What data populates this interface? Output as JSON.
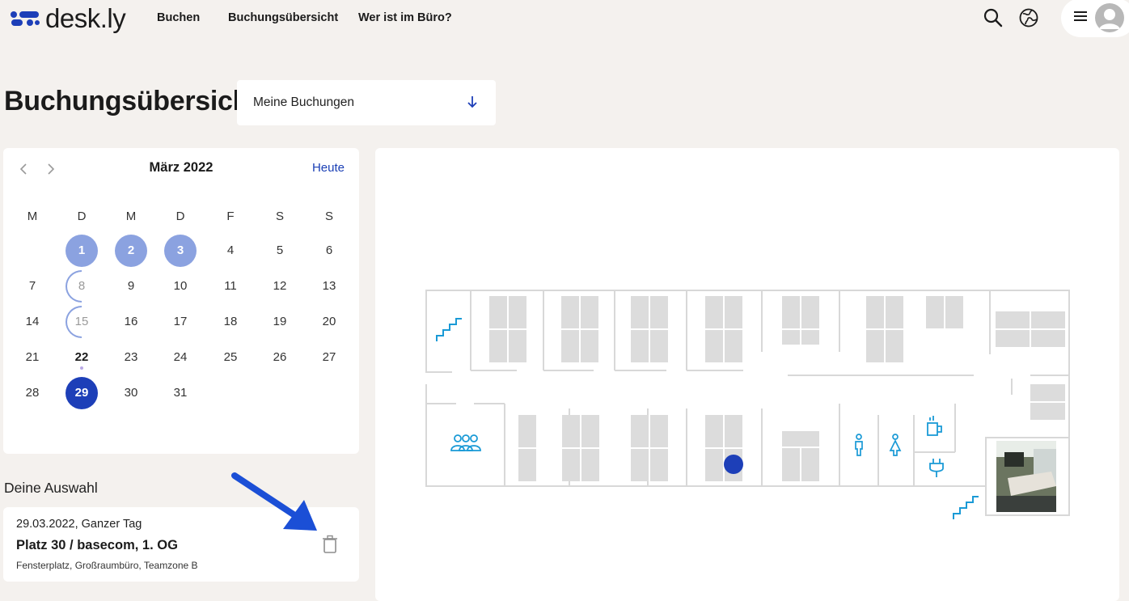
{
  "app": {
    "logo_text": "desk.ly"
  },
  "nav": {
    "items": [
      "Buchen",
      "Buchungsübersicht",
      "Wer ist im Büro?"
    ]
  },
  "page": {
    "title": "Buchungsübersicht",
    "filter": {
      "selected": "Meine Buchungen"
    }
  },
  "calendar": {
    "month_label": "März 2022",
    "today_label": "Heute",
    "weekdays": [
      "M",
      "D",
      "M",
      "D",
      "F",
      "S",
      "S"
    ],
    "days": {
      "d1": "1",
      "d2": "2",
      "d3": "3",
      "d4": "4",
      "d5": "5",
      "d6": "6",
      "d7": "7",
      "d8": "8",
      "d9": "9",
      "d10": "10",
      "d11": "11",
      "d12": "12",
      "d13": "13",
      "d14": "14",
      "d15": "15",
      "d16": "16",
      "d17": "17",
      "d18": "18",
      "d19": "19",
      "d20": "20",
      "d21": "21",
      "d22": "22",
      "d23": "23",
      "d24": "24",
      "d25": "25",
      "d26": "26",
      "d27": "27",
      "d28": "28",
      "d29": "29",
      "d30": "30",
      "d31": "31"
    },
    "booked_days": [
      1,
      2,
      3
    ],
    "partial_days": [
      8,
      15
    ],
    "selected_day": 29,
    "today_day": 22
  },
  "selection": {
    "section_label": "Deine Auswahl",
    "date_line": "29.03.2022, Ganzer Tag",
    "place": "Platz 30 / basecom, 1. OG",
    "details": "Fensterplatz, Großraumbüro, Teamzone B"
  },
  "colors": {
    "accent": "#1d3fb8",
    "booked": "#8ba2e0",
    "icon_blue": "#1a9ad6",
    "background": "#f4f1ee"
  }
}
